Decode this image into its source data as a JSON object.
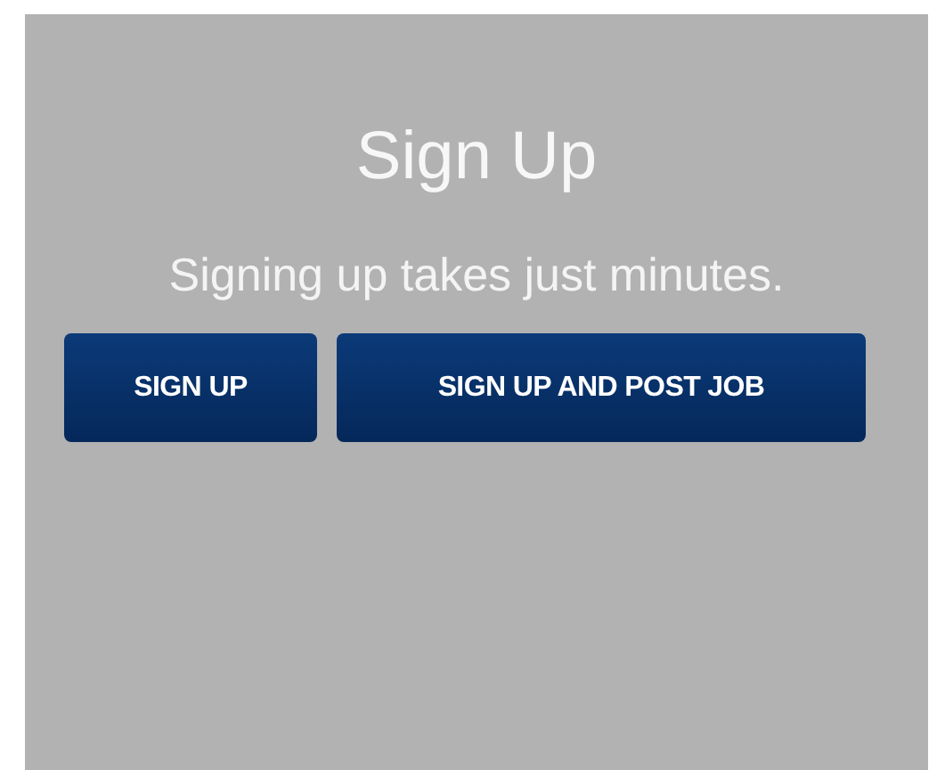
{
  "panel": {
    "title": "Sign Up",
    "subtitle": "Signing up takes just minutes.",
    "buttons": [
      {
        "label": "SIGN UP"
      },
      {
        "label": "SIGN UP AND POST JOB"
      }
    ]
  }
}
